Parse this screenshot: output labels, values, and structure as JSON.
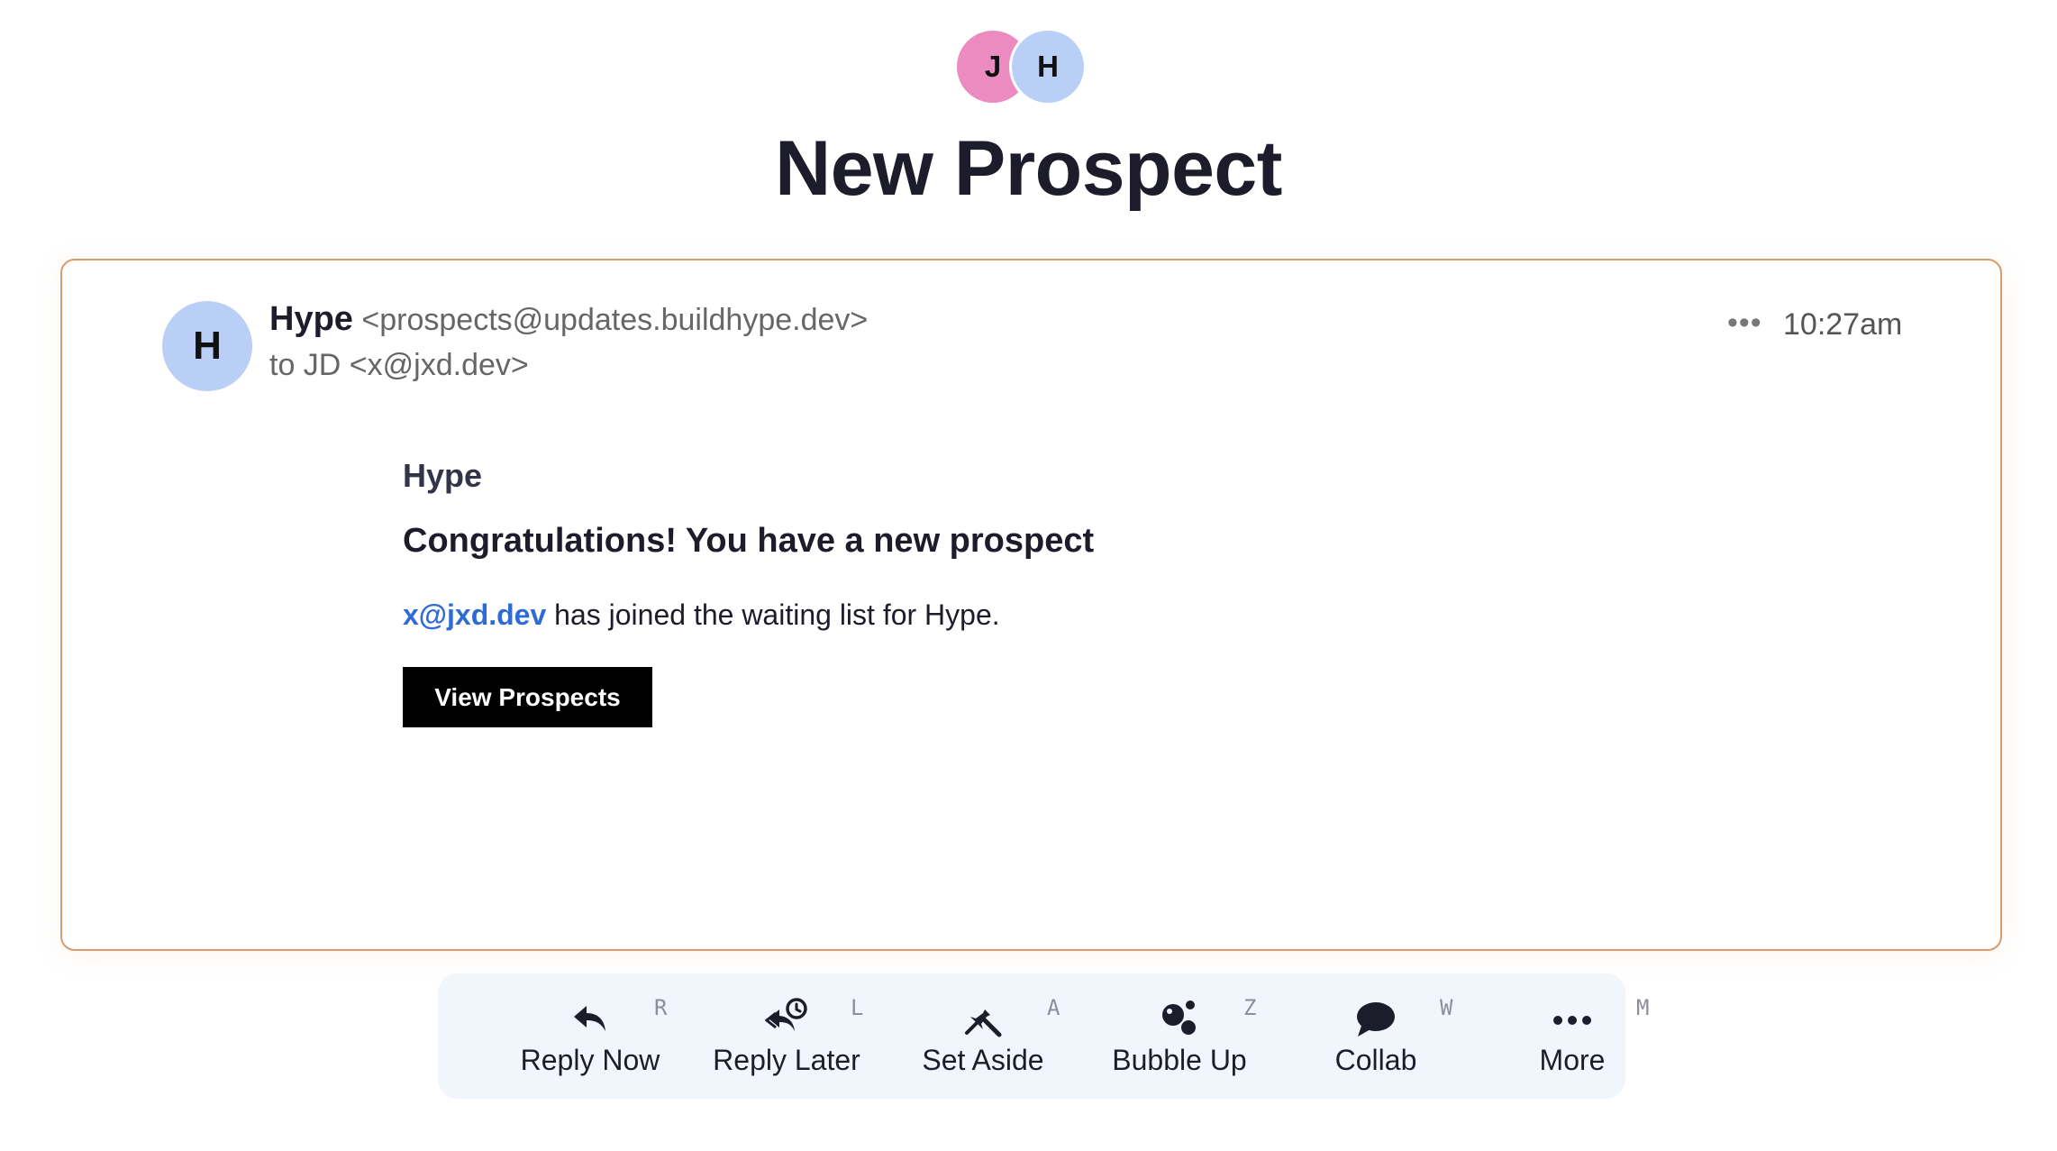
{
  "participants": [
    {
      "initial": "J",
      "color": "#ec8bbf"
    },
    {
      "initial": "H",
      "color": "#b9cff6"
    }
  ],
  "page_title": "New Prospect",
  "message": {
    "sender_initial": "H",
    "sender_name": "Hype",
    "sender_email": "<prospects@updates.buildhype.dev>",
    "to": "to JD <x@jxd.dev>",
    "time": "10:27am",
    "more_label": "•••"
  },
  "body": {
    "brand": "Hype",
    "heading": "Congratulations! You have a new prospect",
    "link_text": "x@jxd.dev",
    "text_after_link": " has joined the waiting list for Hype.",
    "button_label": "View Prospects"
  },
  "toolbar": {
    "items": [
      {
        "label": "Reply Now",
        "key": "R",
        "icon": "reply-icon"
      },
      {
        "label": "Reply Later",
        "key": "L",
        "icon": "reply-later-icon"
      },
      {
        "label": "Set Aside",
        "key": "A",
        "icon": "pin-icon"
      },
      {
        "label": "Bubble Up",
        "key": "Z",
        "icon": "bubbles-icon"
      },
      {
        "label": "Collab",
        "key": "W",
        "icon": "chat-bubble-icon"
      },
      {
        "label": "More",
        "key": "M",
        "icon": "ellipsis-icon"
      }
    ]
  },
  "colors": {
    "accent_border": "#d99a6c",
    "link": "#2f6bd6",
    "toolbar_bg": "#f1f6fd"
  }
}
